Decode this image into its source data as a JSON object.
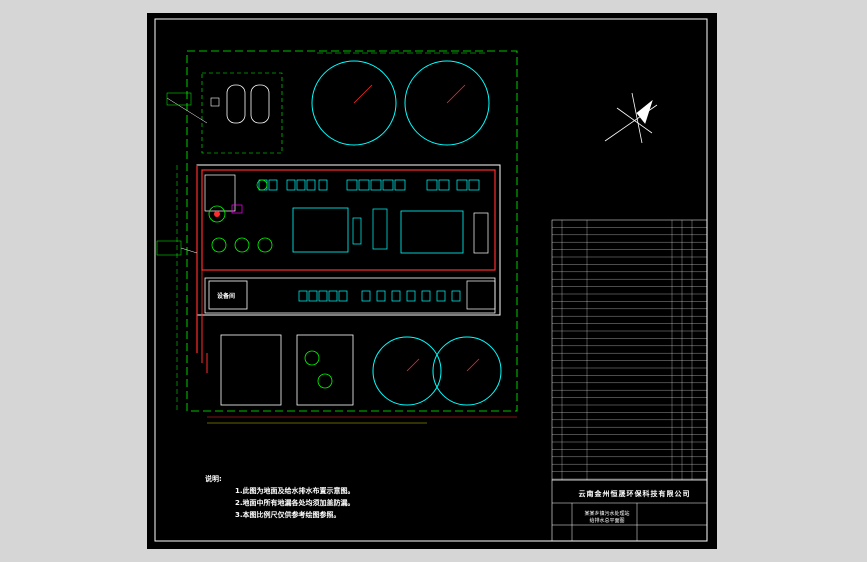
{
  "notes": {
    "heading": "说明:",
    "items": [
      "1.此图为地面及给水排水布置示意图。",
      "2.地面中所有地漏各处均须加盖防漏。",
      "3.本图比例尺仅供参考绘图参照。"
    ]
  },
  "title_block": {
    "company": "云南金州恒晟环保科技有限公司",
    "drawing_title_line1": "某某乡镇污水处理站",
    "drawing_title_line2": "给排水总平面图"
  },
  "labels": {
    "equipment_room": "设备间"
  },
  "colors": {
    "background": "#000000",
    "outline": "#ffffff",
    "structure": "#ff2b2b",
    "tank": "#00ffff",
    "pipe": "#00ff00",
    "accent": "#ff00ff",
    "dim": "#ffff00"
  }
}
